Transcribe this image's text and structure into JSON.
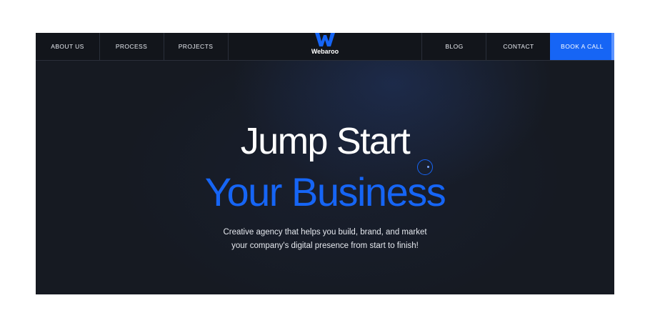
{
  "nav": {
    "left_items": [
      "ABOUT US",
      "PROCESS",
      "PROJECTS"
    ],
    "right_items": [
      "BLOG",
      "CONTACT"
    ],
    "cta": "BOOK A CALL"
  },
  "brand": {
    "name": "Webaroo",
    "logo_icon": "w-logo-icon",
    "color": "#1665F5"
  },
  "hero": {
    "line1": "Jump Start",
    "line2": "Your Business",
    "subtitle_line1": "Creative agency that helps you build, brand, and market",
    "subtitle_line2": "your company's digital presence from start to finish!"
  },
  "colors": {
    "background": "#161A22",
    "accent": "#1665F5",
    "text": "#FFFFFF"
  }
}
